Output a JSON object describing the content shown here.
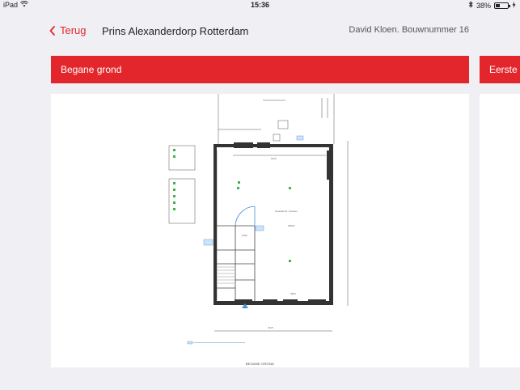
{
  "status_bar": {
    "device": "iPad",
    "time": "15:36",
    "battery": "38%",
    "battery_level": 0.38
  },
  "nav": {
    "back_label": "Terug",
    "title": "Prins Alexanderdorp Rotterdam",
    "user_info": "David Kloen. Bouwnummer 16"
  },
  "floors": [
    {
      "title": "Begane grond",
      "plan_label": "BEGANE GROND"
    },
    {
      "title": "Eerste v"
    }
  ],
  "colors": {
    "accent": "#e3262b",
    "background": "#f0eff4"
  }
}
